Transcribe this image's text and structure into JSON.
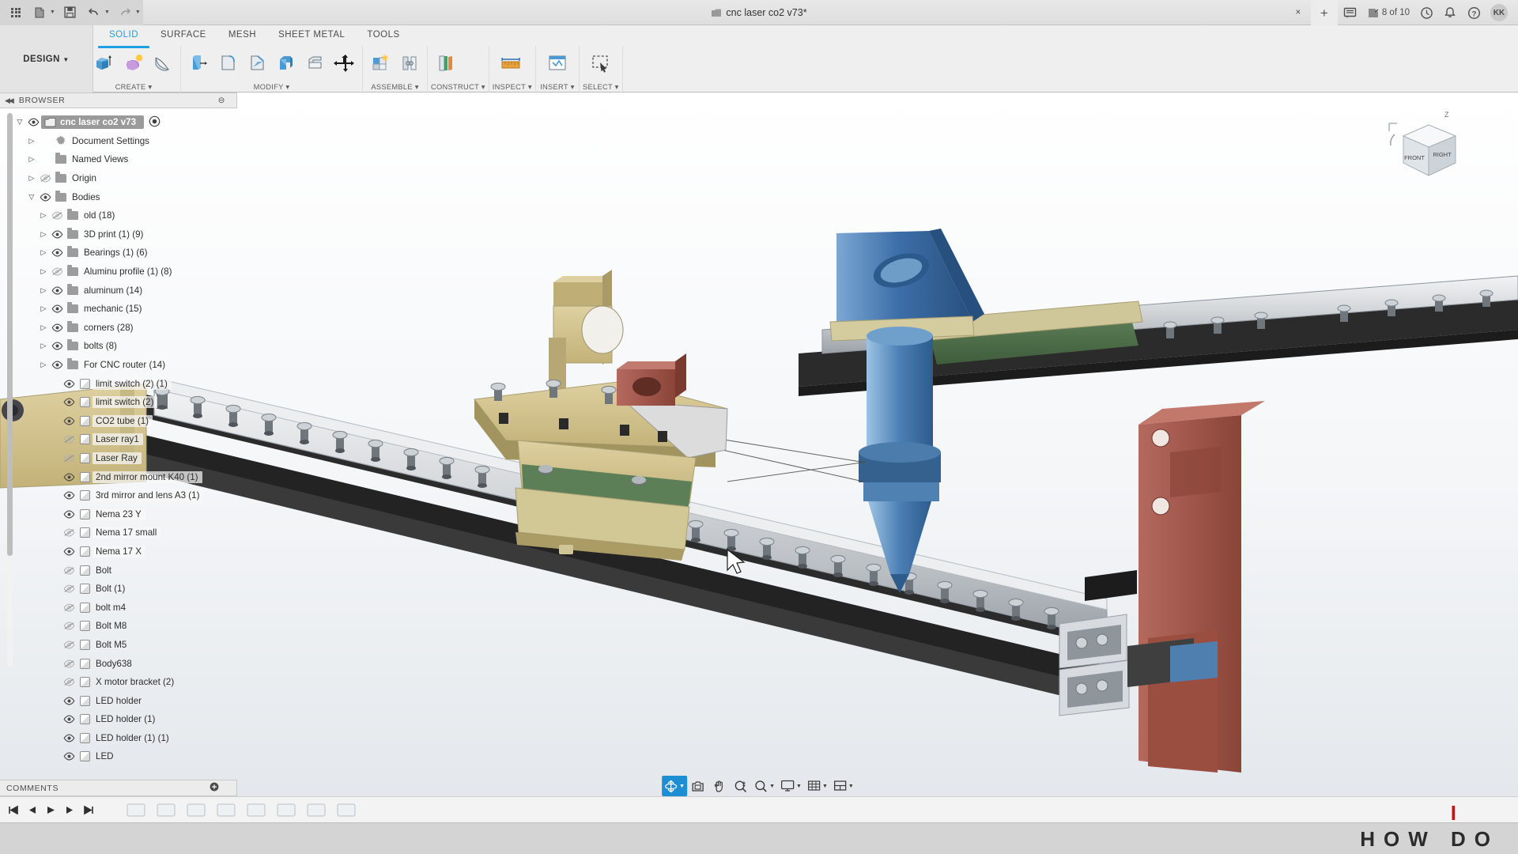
{
  "app": {
    "document_title": "cnc laser co2 v73*",
    "user_initials": "KK",
    "version_counter": "8 of 10"
  },
  "quick_access": {
    "items": [
      {
        "name": "app-grid",
        "icon": "grid-icon",
        "label": "Show Data Panel"
      },
      {
        "name": "new-file",
        "icon": "file-icon",
        "label": "File"
      },
      {
        "name": "save",
        "icon": "save-icon",
        "label": "Save"
      },
      {
        "name": "undo",
        "icon": "undo-icon",
        "label": "Undo"
      },
      {
        "name": "redo",
        "icon": "redo-icon",
        "label": "Redo"
      }
    ]
  },
  "title_right": {
    "close_label": "×",
    "add_tab_label": "+",
    "comment_icon": "comment-icon",
    "version_icon": "version-icon",
    "recent_icon": "clock-icon",
    "notify_icon": "bell-icon",
    "help_icon": "help-icon"
  },
  "ribbon": {
    "workspace_label": "DESIGN",
    "tabs": [
      {
        "label": "SOLID",
        "active": true
      },
      {
        "label": "SURFACE",
        "active": false
      },
      {
        "label": "MESH",
        "active": false
      },
      {
        "label": "SHEET METAL",
        "active": false
      },
      {
        "label": "TOOLS",
        "active": false
      }
    ],
    "panels": [
      {
        "label": "CREATE ▾",
        "name": "panel-create",
        "tools": [
          "extrude-icon",
          "revolve-icon",
          "loft-icon"
        ]
      },
      {
        "label": "MODIFY ▾",
        "name": "panel-modify",
        "tools": [
          "press-pull-icon",
          "fillet-icon",
          "chamfer-icon",
          "shell-icon",
          "draft-icon",
          "scale-icon",
          "move-copy-icon"
        ]
      },
      {
        "label": "ASSEMBLE ▾",
        "name": "panel-assemble",
        "tools": [
          "new-component-icon",
          "joint-icon"
        ]
      },
      {
        "label": "CONSTRUCT ▾",
        "name": "panel-construct",
        "tools": [
          "offset-plane-icon"
        ]
      },
      {
        "label": "INSPECT ▾",
        "name": "panel-inspect",
        "tools": [
          "measure-icon"
        ]
      },
      {
        "label": "INSERT ▾",
        "name": "panel-insert",
        "tools": [
          "insert-mcmaster-icon"
        ]
      },
      {
        "label": "SELECT ▾",
        "name": "panel-select",
        "tools": [
          "select-window-icon"
        ]
      }
    ]
  },
  "browser": {
    "header": "BROWSER",
    "root": {
      "label": "cnc laser co2 v73",
      "selected": true,
      "expanded": true,
      "visible": true
    },
    "items": [
      {
        "label": "Document Settings",
        "type": "settings",
        "indent": 1,
        "arrow": true,
        "expanded": false,
        "eye": "none",
        "faded": false
      },
      {
        "label": "Named Views",
        "type": "folder",
        "indent": 1,
        "arrow": true,
        "expanded": false,
        "eye": "none",
        "faded": false
      },
      {
        "label": "Origin",
        "type": "folder",
        "indent": 1,
        "arrow": true,
        "expanded": false,
        "eye": "hidden",
        "faded": false
      },
      {
        "label": "Bodies",
        "type": "folder",
        "indent": 1,
        "arrow": true,
        "expanded": true,
        "eye": "visible",
        "faded": false
      },
      {
        "label": "old (18)",
        "type": "folder",
        "indent": 2,
        "arrow": true,
        "expanded": false,
        "eye": "hidden",
        "faded": false
      },
      {
        "label": "3D print (1) (9)",
        "type": "folder",
        "indent": 2,
        "arrow": true,
        "expanded": false,
        "eye": "visible",
        "faded": false
      },
      {
        "label": "Bearings (1) (6)",
        "type": "folder",
        "indent": 2,
        "arrow": true,
        "expanded": false,
        "eye": "visible",
        "faded": false
      },
      {
        "label": "Aluminu profile (1) (8)",
        "type": "folder",
        "indent": 2,
        "arrow": true,
        "expanded": false,
        "eye": "hidden",
        "faded": false
      },
      {
        "label": "aluminum (14)",
        "type": "folder",
        "indent": 2,
        "arrow": true,
        "expanded": false,
        "eye": "visible",
        "faded": false
      },
      {
        "label": "mechanic (15)",
        "type": "folder",
        "indent": 2,
        "arrow": true,
        "expanded": false,
        "eye": "visible",
        "faded": false
      },
      {
        "label": "corners (28)",
        "type": "folder",
        "indent": 2,
        "arrow": true,
        "expanded": false,
        "eye": "visible",
        "faded": false
      },
      {
        "label": "bolts (8)",
        "type": "folder",
        "indent": 2,
        "arrow": true,
        "expanded": false,
        "eye": "visible",
        "faded": true
      },
      {
        "label": "For CNC router (14)",
        "type": "folder",
        "indent": 2,
        "arrow": true,
        "expanded": false,
        "eye": "visible",
        "faded": true
      },
      {
        "label": "limit switch (2) (1)",
        "type": "body",
        "indent": 3,
        "arrow": false,
        "eye": "visible",
        "faded": true
      },
      {
        "label": "limit switch (2)",
        "type": "body",
        "indent": 3,
        "arrow": false,
        "eye": "visible",
        "faded": true
      },
      {
        "label": "CO2 tube (1)",
        "type": "body",
        "indent": 3,
        "arrow": false,
        "eye": "visible",
        "faded": true
      },
      {
        "label": "Laser ray1",
        "type": "body",
        "indent": 3,
        "arrow": false,
        "eye": "hidden",
        "faded": true
      },
      {
        "label": "Laser Ray",
        "type": "body",
        "indent": 3,
        "arrow": false,
        "eye": "hidden",
        "faded": true
      },
      {
        "label": "2nd mirror mount K40 (1)",
        "type": "body",
        "indent": 3,
        "arrow": false,
        "eye": "visible",
        "faded": true
      },
      {
        "label": "3rd mirror and lens A3 (1)",
        "type": "body",
        "indent": 3,
        "arrow": false,
        "eye": "visible",
        "faded": true
      },
      {
        "label": "Nema 23 Y",
        "type": "body",
        "indent": 3,
        "arrow": false,
        "eye": "visible",
        "faded": true
      },
      {
        "label": "Nema 17 small",
        "type": "body",
        "indent": 3,
        "arrow": false,
        "eye": "hidden",
        "faded": true
      },
      {
        "label": "Nema 17 X",
        "type": "body",
        "indent": 3,
        "arrow": false,
        "eye": "visible",
        "faded": true
      },
      {
        "label": "Bolt",
        "type": "body",
        "indent": 3,
        "arrow": false,
        "eye": "hidden",
        "faded": false
      },
      {
        "label": "Bolt (1)",
        "type": "body",
        "indent": 3,
        "arrow": false,
        "eye": "hidden",
        "faded": false
      },
      {
        "label": "bolt m4",
        "type": "body",
        "indent": 3,
        "arrow": false,
        "eye": "hidden",
        "faded": false
      },
      {
        "label": "Bolt M8",
        "type": "body",
        "indent": 3,
        "arrow": false,
        "eye": "hidden",
        "faded": false
      },
      {
        "label": "Bolt M5",
        "type": "body",
        "indent": 3,
        "arrow": false,
        "eye": "hidden",
        "faded": false
      },
      {
        "label": "Body638",
        "type": "body",
        "indent": 3,
        "arrow": false,
        "eye": "hidden",
        "faded": false
      },
      {
        "label": "X motor bracket (2)",
        "type": "body",
        "indent": 3,
        "arrow": false,
        "eye": "hidden",
        "faded": false
      },
      {
        "label": "LED holder",
        "type": "body",
        "indent": 3,
        "arrow": false,
        "eye": "visible",
        "faded": false
      },
      {
        "label": "LED holder (1)",
        "type": "body",
        "indent": 3,
        "arrow": false,
        "eye": "visible",
        "faded": false
      },
      {
        "label": "LED holder (1) (1)",
        "type": "body",
        "indent": 3,
        "arrow": false,
        "eye": "visible",
        "faded": false
      },
      {
        "label": "LED",
        "type": "body",
        "indent": 3,
        "arrow": false,
        "eye": "visible",
        "faded": false
      }
    ]
  },
  "comments": {
    "label": "COMMENTS",
    "add_icon": "plus-circle-icon"
  },
  "viewcube": {
    "faces": [
      "FRONT",
      "RIGHT"
    ],
    "axis_label": "Z"
  },
  "navbar": {
    "buttons": [
      {
        "name": "orbit-tool",
        "icon": "orbit-icon",
        "active": true,
        "caret": true
      },
      {
        "name": "look-at-tool",
        "icon": "look-at-icon",
        "active": false,
        "caret": false
      },
      {
        "name": "pan-tool",
        "icon": "pan-hand-icon",
        "active": false,
        "caret": false
      },
      {
        "name": "zoom-tool",
        "icon": "zoom-magnifier-icon",
        "active": false,
        "caret": false
      },
      {
        "name": "fit-tool",
        "icon": "fit-window-icon",
        "active": false,
        "caret": true
      },
      {
        "name": "display-settings",
        "icon": "monitor-icon",
        "active": false,
        "caret": true
      },
      {
        "name": "grid-snaps",
        "icon": "grid-table-icon",
        "active": false,
        "caret": true
      },
      {
        "name": "viewports",
        "icon": "viewports-icon",
        "active": false,
        "caret": true
      }
    ]
  },
  "timeline": {
    "controls": [
      "skip-start-icon",
      "step-back-icon",
      "play-icon",
      "step-forward-icon",
      "skip-end-icon"
    ],
    "features_count": 8
  },
  "watermark": {
    "text": "HOW   DO",
    "accent_color": "#cc2222",
    "mark": "I"
  }
}
